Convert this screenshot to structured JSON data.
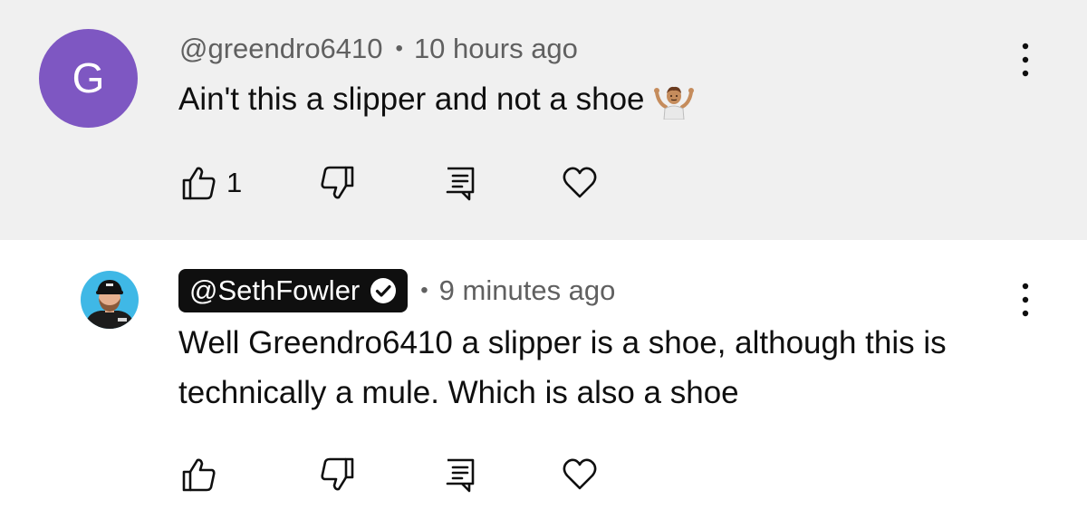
{
  "comments": [
    {
      "avatar_letter": "G",
      "avatar_color": "#7e57c2",
      "handle": "@greendro6410",
      "separator": "•",
      "timestamp": "10 hours ago",
      "text": "Ain't this a slipper and not a shoe",
      "emoji": "shrug-person-emoji",
      "like_count": "1",
      "background": "#f0f0f0"
    },
    {
      "handle": "@SethFowler",
      "verified": true,
      "is_creator": true,
      "separator": "•",
      "timestamp": "9 minutes ago",
      "text": "Well Greendro6410 a slipper is a shoe, although this is technically a mule. Which is also a shoe",
      "like_count": "",
      "background": "#ffffff"
    }
  ],
  "icons": {
    "like": "thumbs-up-icon",
    "dislike": "thumbs-down-icon",
    "reply": "reply-icon",
    "heart": "heart-icon",
    "more": "more-vertical-icon",
    "verified": "verified-check-icon"
  },
  "colors": {
    "secondary_text": "#606060",
    "primary_text": "#0f0f0f",
    "creator_chip": "#0f0f0f"
  }
}
